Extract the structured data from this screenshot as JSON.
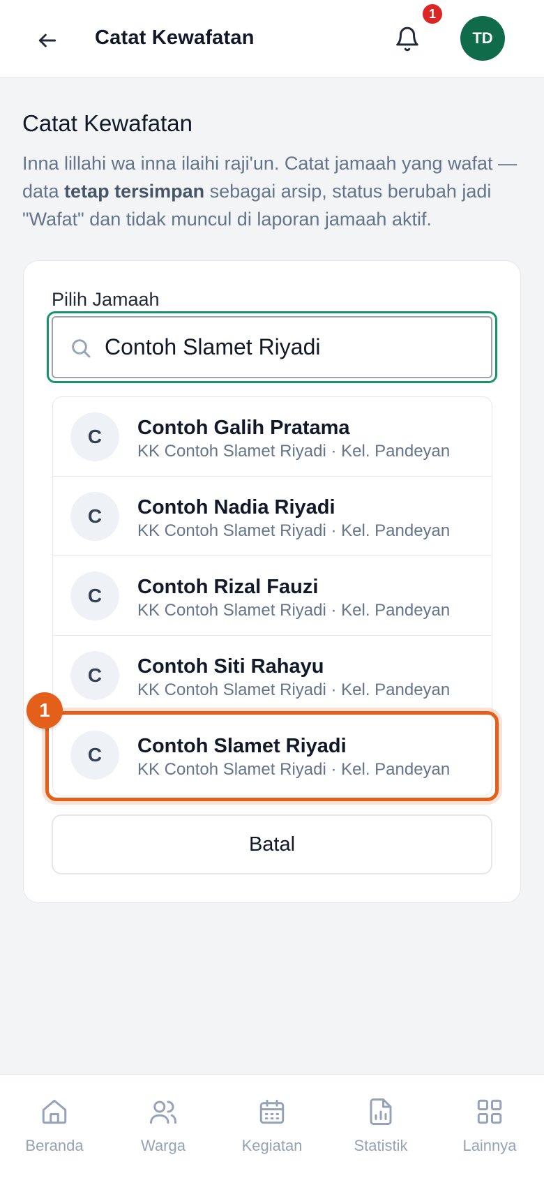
{
  "header": {
    "title": "Catat Kewafatan",
    "notification_count": "1",
    "avatar_initials": "TD"
  },
  "page": {
    "title": "Catat Kewafatan",
    "desc_before": "Inna lillahi wa inna ilaihi raji'un. Catat jamaah yang wafat — data ",
    "desc_bold": "tetap tersimpan",
    "desc_after": " sebagai arsip, status berubah jadi \"Wafat\" dan tidak muncul di laporan jamaah aktif."
  },
  "form": {
    "label": "Pilih Jamaah",
    "search_value": "Contoh Slamet Riyadi",
    "results": [
      {
        "initial": "C",
        "name": "Contoh Galih Pratama",
        "sub": "KK Contoh Slamet Riyadi · Kel. Pandeyan"
      },
      {
        "initial": "C",
        "name": "Contoh Nadia Riyadi",
        "sub": "KK Contoh Slamet Riyadi · Kel. Pandeyan"
      },
      {
        "initial": "C",
        "name": "Contoh Rizal Fauzi",
        "sub": "KK Contoh Slamet Riyadi · Kel. Pandeyan"
      },
      {
        "initial": "C",
        "name": "Contoh Siti Rahayu",
        "sub": "KK Contoh Slamet Riyadi · Kel. Pandeyan"
      },
      {
        "initial": "C",
        "name": "Contoh Slamet Riyadi",
        "sub": "KK Contoh Slamet Riyadi · Kel. Pandeyan"
      }
    ],
    "step_badge": "1",
    "cancel_label": "Batal"
  },
  "nav": {
    "items": [
      {
        "label": "Beranda",
        "icon": "home-icon"
      },
      {
        "label": "Warga",
        "icon": "users-icon"
      },
      {
        "label": "Kegiatan",
        "icon": "calendar-icon"
      },
      {
        "label": "Statistik",
        "icon": "chart-file-icon"
      },
      {
        "label": "Lainnya",
        "icon": "grid-icon"
      }
    ]
  },
  "colors": {
    "accent_green": "#0f6b4a",
    "focus_ring": "#16936a",
    "highlight_orange": "#e4601a",
    "badge_red": "#dc2626"
  }
}
